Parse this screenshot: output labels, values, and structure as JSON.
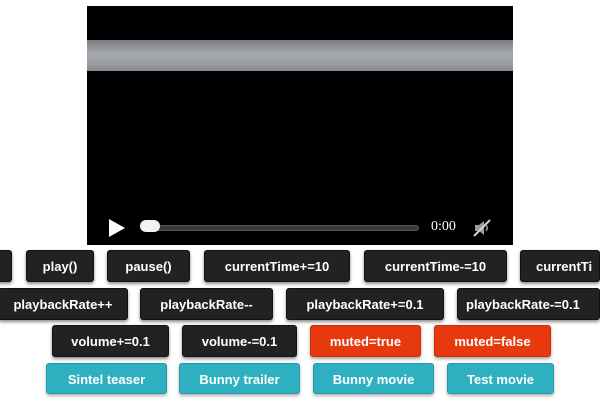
{
  "player": {
    "time": "0:00",
    "play_icon": "play-icon",
    "mute_icon": "muted-speaker-icon",
    "progress": 0
  },
  "controls": {
    "row1": [
      "",
      "play()",
      "pause()",
      "currentTime+=10",
      "currentTime-=10",
      "currentTi"
    ],
    "row2": [
      "playbackRate++",
      "playbackRate--",
      "playbackRate+=0.1",
      "playbackRate-=0.1"
    ],
    "row3": [
      "volume+=0.1",
      "volume-=0.1",
      "muted=true",
      "muted=false"
    ],
    "row4": [
      "Sintel teaser",
      "Bunny trailer",
      "Bunny movie",
      "Test movie"
    ]
  },
  "colors": {
    "dark_button": "#222222",
    "red_button": "#e8380d",
    "teal_button": "#2fb0c0",
    "video_bg": "#000000"
  }
}
